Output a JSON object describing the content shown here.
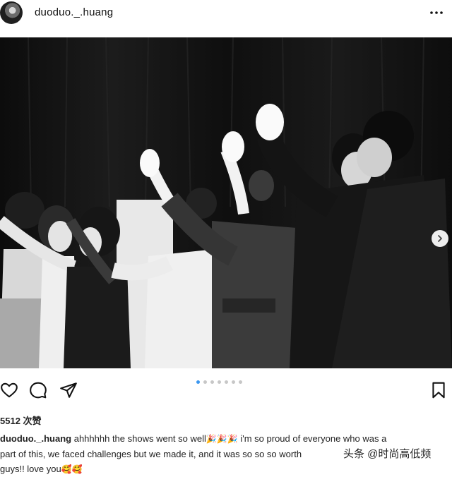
{
  "post": {
    "username": "duoduo._.huang",
    "likes_text": "5512 次赞",
    "caption": {
      "username": "duoduo._.huang",
      "line1_text": "ahhhhhh the shows went so well",
      "line1_emoji": "🎉🎉🎉",
      "line1_rest": "i'm so proud of everyone who was a",
      "line2_text": "part of this, we faced challenges but we made it, and it was so so so worth",
      "line3_text": "guys!! love you",
      "line3_emoji": "🥰🥰"
    },
    "carousel": {
      "count": 7,
      "active_index": 0
    }
  },
  "watermark": {
    "text": "头条 @时尚高低频"
  },
  "icons": {
    "more": "more-horizontal-icon",
    "like": "heart-icon",
    "comment": "comment-icon",
    "share": "send-icon",
    "save": "bookmark-icon",
    "next": "chevron-right-icon"
  },
  "colors": {
    "carousel_active": "#3b97f0",
    "carousel_inactive": "#c7c7c7"
  }
}
